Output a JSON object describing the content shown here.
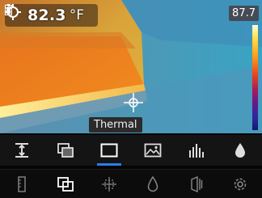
{
  "readout": {
    "value": "82.3",
    "unit": "°F"
  },
  "status_icons": [
    "battery-icon",
    "bluetooth-icon"
  ],
  "scale": {
    "max_label": "87.7"
  },
  "mode_label": "Thermal",
  "toolbar_top": [
    {
      "icon": "level-span-icon",
      "active": false
    },
    {
      "icon": "picture-in-picture-icon",
      "active": false
    },
    {
      "icon": "thermal-frame-icon",
      "active": true
    },
    {
      "icon": "visual-image-icon",
      "active": false
    },
    {
      "icon": "histogram-icon",
      "active": false
    },
    {
      "icon": "dew-point-icon",
      "active": false
    }
  ],
  "toolbar_bottom": [
    {
      "icon": "palette-bar-icon"
    },
    {
      "icon": "overlay-icon"
    },
    {
      "icon": "spot-meter-icon"
    },
    {
      "icon": "humidity-icon"
    },
    {
      "icon": "emissivity-icon"
    },
    {
      "icon": "settings-gear-icon"
    }
  ],
  "colors": {
    "accent": "#2b7de9",
    "scale_top": "#fffde0",
    "scale_bottom": "#0f1b6e"
  }
}
